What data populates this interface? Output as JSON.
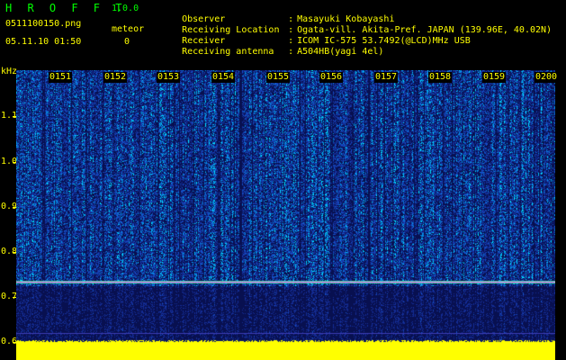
{
  "header": {
    "app_title": "H R O F F T",
    "version": "1.0.0",
    "filename": "0511100150.png",
    "datetime": "05.11.10 01:50",
    "meteor_label": "meteor",
    "meteor_count": "0"
  },
  "info": [
    {
      "label": "Observer",
      "value": "Masayuki Kobayashi"
    },
    {
      "label": "Receiving Location",
      "value": "Ogata-vill. Akita-Pref. JAPAN (139.96E, 40.02N)"
    },
    {
      "label": "Receiver",
      "value": "ICOM IC-575 53.7492(@LCD)MHz USB"
    },
    {
      "label": "Receiving antenna",
      "value": "A504HB(yagi 4el)"
    }
  ],
  "axis": {
    "y_unit": "kHz",
    "y_labels": [
      "1.1",
      "1.0",
      "0.9",
      "0.8",
      "0.7",
      "0.6"
    ],
    "x_labels": [
      "0151",
      "0152",
      "0153",
      "0154",
      "0155",
      "0156",
      "0157",
      "0158",
      "0159",
      "0200"
    ]
  },
  "colors": {
    "header_text": "#ffff00",
    "title_text": "#00ff00",
    "background": "#000000",
    "spectrogram_low": "#0a1a6a",
    "spectrogram_high": "#00ffff",
    "carrier_line": "#ff40ff",
    "bottom_band": "#ffff00"
  }
}
